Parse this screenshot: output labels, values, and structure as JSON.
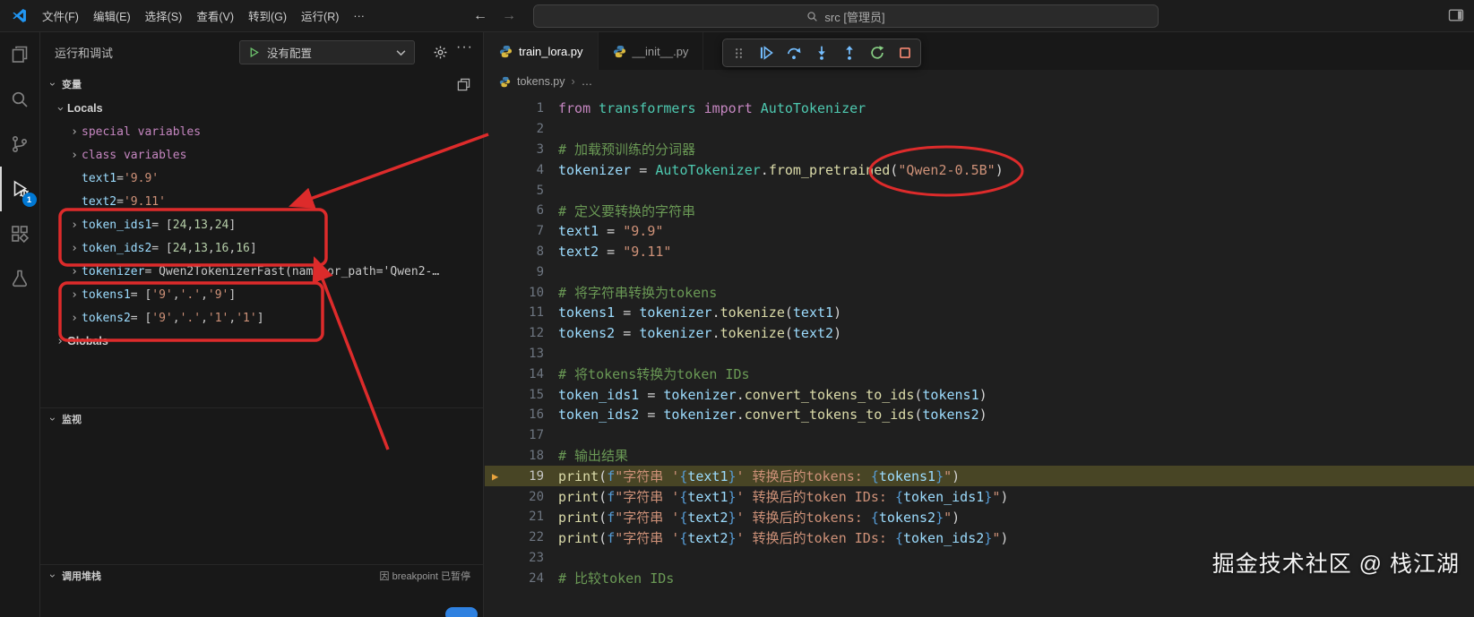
{
  "titlebar": {
    "menus": [
      "文件(F)",
      "编辑(E)",
      "选择(S)",
      "查看(V)",
      "转到(G)",
      "运行(R)",
      "···"
    ],
    "search_text": "src [管理员]"
  },
  "activity_bar": {
    "items": [
      "explorer",
      "search",
      "source-control",
      "run-and-debug",
      "extensions",
      "testing"
    ],
    "active_item": "run-and-debug",
    "debug_badge": "1"
  },
  "sidebar": {
    "title": "运行和调试",
    "config_label": "没有配置",
    "variables_header": "变量",
    "watch_header": "监视",
    "callstack_header": "调用堆栈",
    "callstack_status": "因 breakpoint 已暂停",
    "variables": [
      {
        "indent": 0,
        "chevron": "expanded",
        "name": "Locals",
        "style": "scope"
      },
      {
        "indent": 1,
        "chevron": "collapsed",
        "name": "special variables",
        "style": "group"
      },
      {
        "indent": 1,
        "chevron": "collapsed",
        "name": "class variables",
        "style": "group"
      },
      {
        "indent": 1,
        "chevron": "none",
        "name": "text1",
        "value": [
          [
            "p",
            " = "
          ],
          [
            "s",
            "'9.9'"
          ]
        ]
      },
      {
        "indent": 1,
        "chevron": "none",
        "name": "text2",
        "value": [
          [
            "p",
            " = "
          ],
          [
            "s",
            "'9.11'"
          ]
        ]
      },
      {
        "indent": 1,
        "chevron": "collapsed",
        "name": "token_ids1",
        "value": [
          [
            "p",
            " = ["
          ],
          [
            "n",
            "24"
          ],
          [
            "p",
            ", "
          ],
          [
            "n",
            "13"
          ],
          [
            "p",
            ", "
          ],
          [
            "n",
            "24"
          ],
          [
            "p",
            "]"
          ]
        ]
      },
      {
        "indent": 1,
        "chevron": "collapsed",
        "name": "token_ids2",
        "value": [
          [
            "p",
            " = ["
          ],
          [
            "n",
            "24"
          ],
          [
            "p",
            ", "
          ],
          [
            "n",
            "13"
          ],
          [
            "p",
            ", "
          ],
          [
            "n",
            "16"
          ],
          [
            "p",
            ", "
          ],
          [
            "n",
            "16"
          ],
          [
            "p",
            "]"
          ]
        ]
      },
      {
        "indent": 1,
        "chevron": "collapsed",
        "name": "tokenizer",
        "value": [
          [
            "p",
            " = Qwen2TokenizerFast(name_or_path='Qwen2-…"
          ]
        ]
      },
      {
        "indent": 1,
        "chevron": "collapsed",
        "name": "tokens1",
        "value": [
          [
            "p",
            " = ["
          ],
          [
            "s",
            "'9'"
          ],
          [
            "p",
            ", "
          ],
          [
            "s",
            "'.'"
          ],
          [
            "p",
            ", "
          ],
          [
            "s",
            "'9'"
          ],
          [
            "p",
            "]"
          ]
        ]
      },
      {
        "indent": 1,
        "chevron": "collapsed",
        "name": "tokens2",
        "value": [
          [
            "p",
            " = ["
          ],
          [
            "s",
            "'9'"
          ],
          [
            "p",
            ", "
          ],
          [
            "s",
            "'.'"
          ],
          [
            "p",
            ", "
          ],
          [
            "s",
            "'1'"
          ],
          [
            "p",
            ", "
          ],
          [
            "s",
            "'1'"
          ],
          [
            "p",
            "]"
          ]
        ]
      },
      {
        "indent": 0,
        "chevron": "collapsed",
        "name": "Globals",
        "style": "scope"
      }
    ]
  },
  "debug_toolbar": [
    "gripper",
    "continue",
    "step-over",
    "step-into",
    "step-out",
    "restart",
    "stop"
  ],
  "editor": {
    "tabs": [
      {
        "label": "train_lora.py",
        "active": true
      },
      {
        "label": "__init__.py",
        "active": false
      }
    ],
    "breadcrumb": [
      "tokens.py",
      "…"
    ],
    "code_lines": [
      {
        "n": 1,
        "t": [
          [
            "k",
            "from"
          ],
          [
            "p",
            " "
          ],
          [
            "c",
            "transformers"
          ],
          [
            "p",
            " "
          ],
          [
            "k",
            "import"
          ],
          [
            "p",
            " "
          ],
          [
            "c",
            "AutoTokenizer"
          ]
        ]
      },
      {
        "n": 2,
        "t": []
      },
      {
        "n": 3,
        "t": [
          [
            "m",
            "# 加载预训练的分词器"
          ]
        ]
      },
      {
        "n": 4,
        "t": [
          [
            "v",
            "tokenizer"
          ],
          [
            "p",
            " = "
          ],
          [
            "c",
            "AutoTokenizer"
          ],
          [
            "p",
            "."
          ],
          [
            "f",
            "from_pretrained"
          ],
          [
            "p",
            "("
          ],
          [
            "s",
            "\"Qwen2-0.5B\""
          ],
          [
            "p",
            ")"
          ]
        ]
      },
      {
        "n": 5,
        "t": []
      },
      {
        "n": 6,
        "t": [
          [
            "m",
            "# 定义要转换的字符串"
          ]
        ]
      },
      {
        "n": 7,
        "t": [
          [
            "v",
            "text1"
          ],
          [
            "p",
            " = "
          ],
          [
            "s",
            "\"9.9\""
          ]
        ]
      },
      {
        "n": 8,
        "t": [
          [
            "v",
            "text2"
          ],
          [
            "p",
            " = "
          ],
          [
            "s",
            "\"9.11\""
          ]
        ]
      },
      {
        "n": 9,
        "t": []
      },
      {
        "n": 10,
        "t": [
          [
            "m",
            "# 将字符串转换为tokens"
          ]
        ]
      },
      {
        "n": 11,
        "t": [
          [
            "v",
            "tokens1"
          ],
          [
            "p",
            " = "
          ],
          [
            "v",
            "tokenizer"
          ],
          [
            "p",
            "."
          ],
          [
            "f",
            "tokenize"
          ],
          [
            "p",
            "("
          ],
          [
            "v",
            "text1"
          ],
          [
            "p",
            ")"
          ]
        ]
      },
      {
        "n": 12,
        "t": [
          [
            "v",
            "tokens2"
          ],
          [
            "p",
            " = "
          ],
          [
            "v",
            "tokenizer"
          ],
          [
            "p",
            "."
          ],
          [
            "f",
            "tokenize"
          ],
          [
            "p",
            "("
          ],
          [
            "v",
            "text2"
          ],
          [
            "p",
            ")"
          ]
        ]
      },
      {
        "n": 13,
        "t": []
      },
      {
        "n": 14,
        "t": [
          [
            "m",
            "# 将tokens转换为token IDs"
          ]
        ]
      },
      {
        "n": 15,
        "t": [
          [
            "v",
            "token_ids1"
          ],
          [
            "p",
            " = "
          ],
          [
            "v",
            "tokenizer"
          ],
          [
            "p",
            "."
          ],
          [
            "f",
            "convert_tokens_to_ids"
          ],
          [
            "p",
            "("
          ],
          [
            "v",
            "tokens1"
          ],
          [
            "p",
            ")"
          ]
        ]
      },
      {
        "n": 16,
        "t": [
          [
            "v",
            "token_ids2"
          ],
          [
            "p",
            " = "
          ],
          [
            "v",
            "tokenizer"
          ],
          [
            "p",
            "."
          ],
          [
            "f",
            "convert_tokens_to_ids"
          ],
          [
            "p",
            "("
          ],
          [
            "v",
            "tokens2"
          ],
          [
            "p",
            ")"
          ]
        ]
      },
      {
        "n": 17,
        "t": []
      },
      {
        "n": 18,
        "t": [
          [
            "m",
            "# 输出结果"
          ]
        ]
      },
      {
        "n": 19,
        "current": true,
        "t": [
          [
            "f",
            "print"
          ],
          [
            "p",
            "("
          ],
          [
            "b",
            "f"
          ],
          [
            "s",
            "\"字符串 '"
          ],
          [
            "b",
            "{"
          ],
          [
            "v",
            "text1"
          ],
          [
            "b",
            "}"
          ],
          [
            "s",
            "' 转换后的tokens: "
          ],
          [
            "b",
            "{"
          ],
          [
            "v",
            "tokens1"
          ],
          [
            "b",
            "}"
          ],
          [
            "s",
            "\""
          ],
          [
            "p",
            ")"
          ]
        ]
      },
      {
        "n": 20,
        "t": [
          [
            "f",
            "print"
          ],
          [
            "p",
            "("
          ],
          [
            "b",
            "f"
          ],
          [
            "s",
            "\"字符串 '"
          ],
          [
            "b",
            "{"
          ],
          [
            "v",
            "text1"
          ],
          [
            "b",
            "}"
          ],
          [
            "s",
            "' 转换后的token IDs: "
          ],
          [
            "b",
            "{"
          ],
          [
            "v",
            "token_ids1"
          ],
          [
            "b",
            "}"
          ],
          [
            "s",
            "\""
          ],
          [
            "p",
            ")"
          ]
        ]
      },
      {
        "n": 21,
        "t": [
          [
            "f",
            "print"
          ],
          [
            "p",
            "("
          ],
          [
            "b",
            "f"
          ],
          [
            "s",
            "\"字符串 '"
          ],
          [
            "b",
            "{"
          ],
          [
            "v",
            "text2"
          ],
          [
            "b",
            "}"
          ],
          [
            "s",
            "' 转换后的tokens: "
          ],
          [
            "b",
            "{"
          ],
          [
            "v",
            "tokens2"
          ],
          [
            "b",
            "}"
          ],
          [
            "s",
            "\""
          ],
          [
            "p",
            ")"
          ]
        ]
      },
      {
        "n": 22,
        "t": [
          [
            "f",
            "print"
          ],
          [
            "p",
            "("
          ],
          [
            "b",
            "f"
          ],
          [
            "s",
            "\"字符串 '"
          ],
          [
            "b",
            "{"
          ],
          [
            "v",
            "text2"
          ],
          [
            "b",
            "}"
          ],
          [
            "s",
            "' 转换后的token IDs: "
          ],
          [
            "b",
            "{"
          ],
          [
            "v",
            "token_ids2"
          ],
          [
            "b",
            "}"
          ],
          [
            "s",
            "\""
          ],
          [
            "p",
            ")"
          ]
        ]
      },
      {
        "n": 23,
        "t": []
      },
      {
        "n": 24,
        "t": [
          [
            "m",
            "# 比较token IDs"
          ]
        ]
      }
    ]
  },
  "watermark": "掘金技术社区 @ 栈江湖",
  "colors": {
    "badge_blue": "#0078d4",
    "annotation_red": "#dd2b2b",
    "current_line_highlight": "#55512a",
    "debug_blue": "#75beff",
    "restart_green": "#89d185",
    "stop_red": "#f48771"
  }
}
